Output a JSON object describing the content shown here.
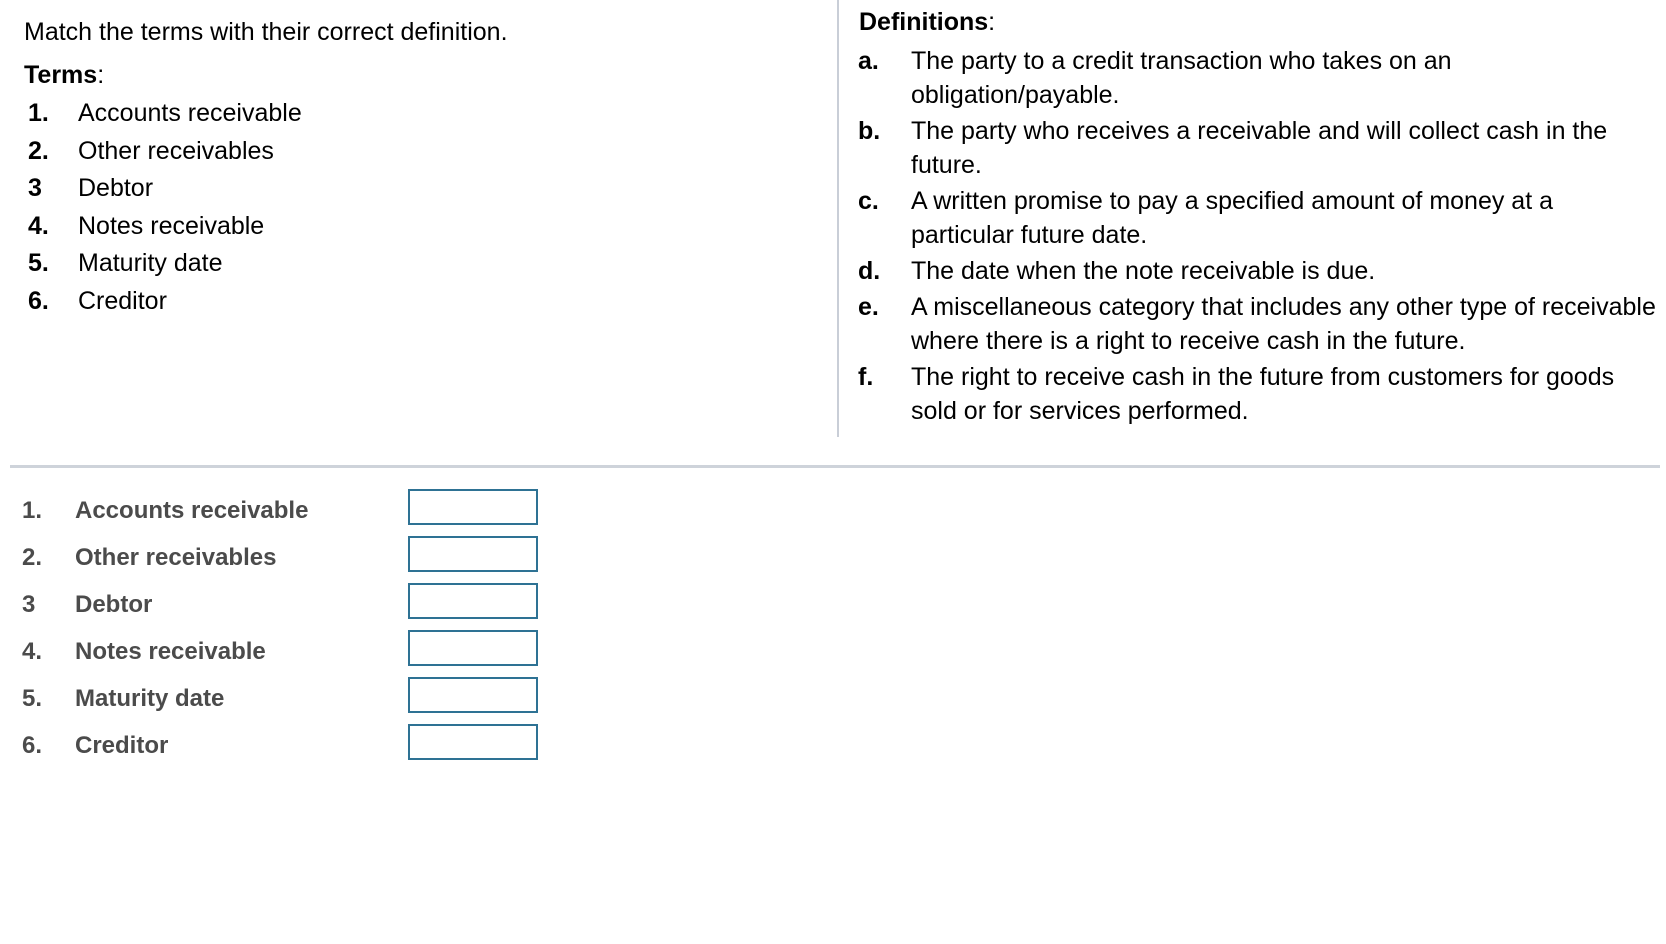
{
  "instruction": "Match the terms with their correct definition.",
  "terms_panel": {
    "heading": "Terms",
    "heading_colon": ":",
    "items": [
      {
        "marker": "1.",
        "label": "Accounts receivable"
      },
      {
        "marker": "2.",
        "label": "Other receivables"
      },
      {
        "marker": "3",
        "label": "Debtor"
      },
      {
        "marker": "4.",
        "label": "Notes receivable"
      },
      {
        "marker": "5.",
        "label": "Maturity date"
      },
      {
        "marker": "6.",
        "label": "Creditor"
      }
    ]
  },
  "definitions_panel": {
    "heading": "Definitions",
    "heading_colon": ":",
    "items": [
      {
        "marker": "a.",
        "text": "The party to a credit transaction who takes on an obligation/payable."
      },
      {
        "marker": "b.",
        "text": "The party who receives a receivable and will collect cash in the future."
      },
      {
        "marker": "c.",
        "text": "A written promise to pay a specified amount of money at a particular future date."
      },
      {
        "marker": "d.",
        "text": "The date when the note receivable is due."
      },
      {
        "marker": "e.",
        "text": "A miscellaneous category that includes any other type of receivable where there is a right to receive cash in the future."
      },
      {
        "marker": "f.",
        "text": "The right to receive cash in the future from customers for goods sold or for services performed."
      }
    ]
  },
  "answer_section": {
    "rows": [
      {
        "marker": "1.",
        "label": "Accounts receivable",
        "value": "",
        "placeholder": ""
      },
      {
        "marker": "2.",
        "label": "Other receivables",
        "value": "",
        "placeholder": ""
      },
      {
        "marker": "3",
        "label": "Debtor",
        "value": "",
        "placeholder": ""
      },
      {
        "marker": "4.",
        "label": "Notes receivable",
        "value": "",
        "placeholder": ""
      },
      {
        "marker": "5.",
        "label": "Maturity date",
        "value": "",
        "placeholder": ""
      },
      {
        "marker": "6.",
        "label": "Creditor",
        "value": "",
        "placeholder": ""
      }
    ]
  },
  "colors": {
    "input_border": "#2e7294",
    "divider": "#ced3da",
    "vertical_divider": "#c9ced7",
    "answer_text": "#4b4b4b",
    "body_text": "#000000"
  }
}
